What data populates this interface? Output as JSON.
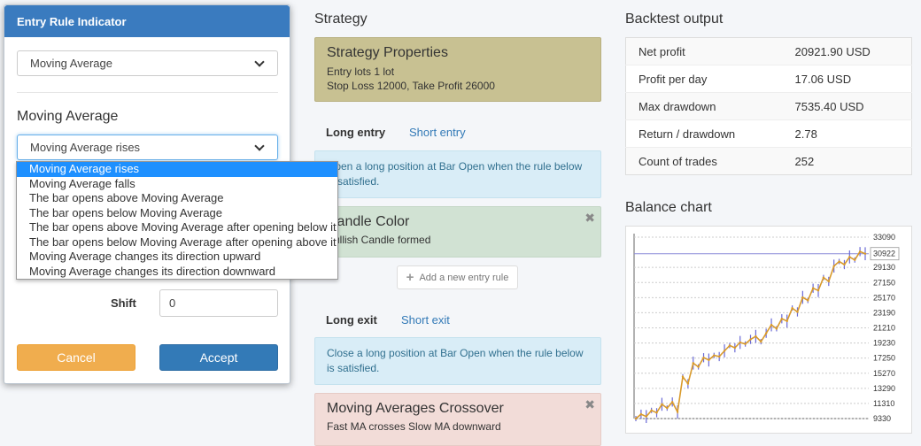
{
  "strategy": {
    "title": "Strategy",
    "properties": {
      "heading": "Strategy Properties",
      "line1": "Entry lots 1 lot",
      "line2": "Stop Loss 12000, Take Profit 26000"
    },
    "entry_tabs": {
      "long": "Long entry",
      "short": "Short entry"
    },
    "entry_info": "Open a long position at Bar Open when the rule below is satisfied.",
    "entry_rule": {
      "heading": "Candle Color",
      "detail": "Bullish Candle formed",
      "close": "✖"
    },
    "add_rule": {
      "icon": "+",
      "label": "Add a new entry rule"
    },
    "exit_tabs": {
      "long": "Long exit",
      "short": "Short exit"
    },
    "exit_info": "Close a long position at Bar Open when the rule below is satisfied.",
    "exit_rule": {
      "heading": "Moving Averages Crossover",
      "detail": "Fast MA crosses Slow MA downward",
      "close": "✖"
    }
  },
  "backtest": {
    "title": "Backtest output",
    "rows": [
      {
        "label": "Net profit",
        "value": "20921.90 USD"
      },
      {
        "label": "Profit per day",
        "value": "17.06 USD"
      },
      {
        "label": "Max drawdown",
        "value": "7535.40 USD"
      },
      {
        "label": "Return / drawdown",
        "value": "2.78"
      },
      {
        "label": "Count of trades",
        "value": "252"
      }
    ]
  },
  "balance_chart": {
    "title": "Balance chart"
  },
  "chart_data": {
    "type": "line",
    "title": "Balance chart",
    "y_ticks": [
      "33090",
      "29130",
      "27150",
      "25170",
      "23190",
      "21210",
      "19230",
      "17250",
      "15270",
      "13290",
      "11310",
      "9330"
    ],
    "current_value_label": "30922",
    "ylim": [
      9330,
      33090
    ],
    "values": [
      9330,
      9900,
      9600,
      10400,
      10100,
      11200,
      10700,
      11500,
      10200,
      14800,
      13900,
      16600,
      16100,
      17300,
      17000,
      17600,
      17450,
      18200,
      18900,
      18600,
      19300,
      19100,
      19700,
      20100,
      19400,
      20500,
      21600,
      21100,
      22400,
      22100,
      23800,
      23300,
      25200,
      24800,
      26400,
      26100,
      27800,
      27300,
      29300,
      29900,
      29500,
      30500,
      30100,
      31200,
      30922
    ],
    "reference_line": 30922,
    "grid": "horizontal dashed",
    "colors": {
      "line": "#d99a2b",
      "wick": "#6b6bd6",
      "ref": "#8a8ad8"
    }
  },
  "modal": {
    "title": "Entry Rule Indicator",
    "indicator_select": "Moving Average",
    "indicator_title": "Moving Average",
    "rule_select": "Moving Average rises",
    "options": [
      "Moving Average rises",
      "Moving Average falls",
      "The bar opens above Moving Average",
      "The bar opens below Moving Average",
      "The bar opens above Moving Average after opening below it",
      "The bar opens below Moving Average after opening above it",
      "Moving Average changes its direction upward",
      "Moving Average changes its direction downward"
    ],
    "shift_label": "Shift",
    "shift_value": "0",
    "cancel": "Cancel",
    "accept": "Accept"
  }
}
